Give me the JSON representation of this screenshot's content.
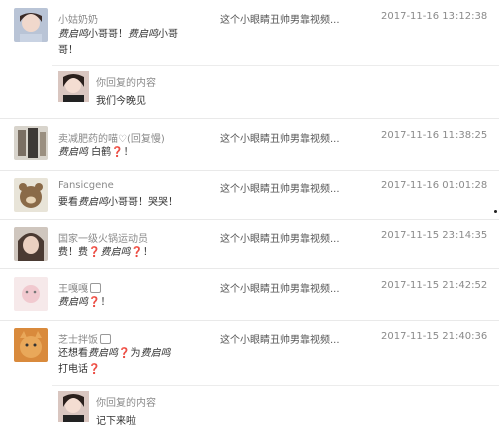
{
  "video_title": "这个小眼睛丑帅男靠视频...",
  "reply_label": "你回复的内容",
  "comments": [
    {
      "user": "小姑奶奶",
      "time": "2017-11-16 13:12:38",
      "line1_hl1": "费启鸣",
      "line1_mid": "小哥哥！",
      "line1_hl2": "费启鸣",
      "line1_end": "小哥",
      "line2": "哥！",
      "reply": "我们今晚见"
    },
    {
      "user": "卖减肥药的喵♡(回复慢)",
      "time": "2017-11-16 11:38:25",
      "hl": "费启鸣",
      "text": " 白鹤",
      "q": "❓",
      "end": "！"
    },
    {
      "user": "Fansicgene",
      "time": "2017-11-16 01:01:28",
      "pre": "要看",
      "hl": "费启鸣",
      "text": "小哥哥！哭哭！"
    },
    {
      "user": "国家一级火锅运动员",
      "time": "2017-11-15 23:14:35",
      "pre": "费！费",
      "q1": "❓",
      "hl": "费启鸣",
      "q2": "❓",
      "end": "！"
    },
    {
      "user": "王嘎嘎",
      "time": "2017-11-15 21:42:52",
      "hl": "费启鸣",
      "q": "❓",
      "end": "！"
    },
    {
      "user": "芝士拌饭",
      "time": "2017-11-15 21:40:36",
      "pre": "还想看",
      "hl": "费启鸣",
      "q": "❓",
      "mid": "为",
      "hl2": "费启鸣",
      "line2": "打电话",
      "q2": "❓",
      "reply": "记下来啦"
    }
  ]
}
